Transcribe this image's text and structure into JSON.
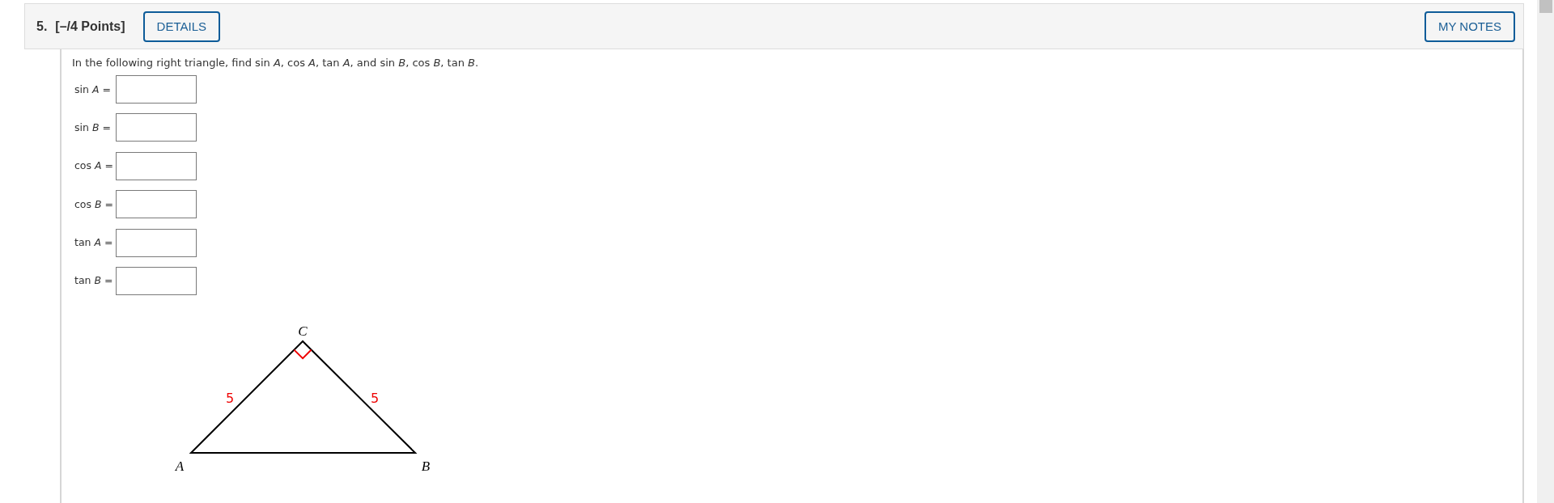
{
  "header": {
    "number": "5.",
    "points": "[–/4 Points]",
    "details_button": "DETAILS",
    "notes_button": "MY NOTES"
  },
  "prompt": "In the following right triangle, find sin *A*, cos *A*, tan *A*, and sin *B*, cos *B*, tan *B*.",
  "answers": [
    {
      "label": "sin *A* ="
    },
    {
      "label": "sin *B* ="
    },
    {
      "label": "cos *A* ="
    },
    {
      "label": "cos *B* ="
    },
    {
      "label": "tan *A* ="
    },
    {
      "label": "tan *B* ="
    }
  ],
  "figure": {
    "vertices": [
      {
        "label": "C",
        "right_angle": true
      },
      {
        "label": "A",
        "right_angle": false
      },
      {
        "label": "B",
        "right_angle": false
      }
    ],
    "sides": [
      {
        "label": "5"
      },
      {
        "label": "5"
      }
    ]
  }
}
